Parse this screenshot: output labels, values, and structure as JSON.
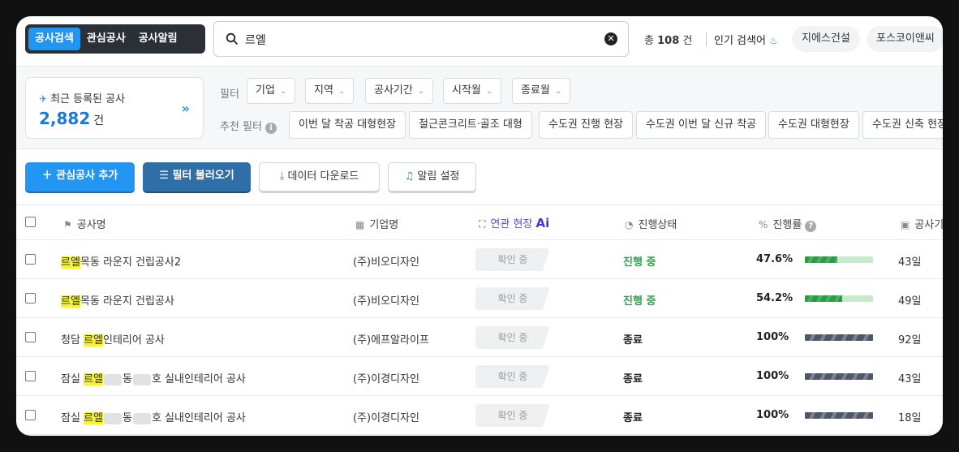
{
  "topbar": {
    "tabs": [
      {
        "label": "공사검색",
        "active": true
      },
      {
        "label": "관심공사",
        "active": false
      },
      {
        "label": "공사알림",
        "active": false
      }
    ],
    "search_value": "르엘",
    "total_prefix": "총",
    "total_count": "108",
    "total_unit": "건",
    "popular_label": "인기 검색어",
    "popular_chips": [
      "지에스건설",
      "포스코이앤씨"
    ]
  },
  "recent": {
    "title": "최근 등록된 공사",
    "count": "2,882",
    "unit": "건"
  },
  "filters": {
    "label": "필터",
    "dropdowns": [
      "기업",
      "지역",
      "공사기간",
      "시작월",
      "종료월"
    ],
    "recommend_label": "추천 필터",
    "recommend_chips": [
      "이번 달 착공 대형현장",
      "철근콘크리트·골조 대형",
      "수도권 진행 현장",
      "수도권 이번 달 신규 착공",
      "수도권 대형현장",
      "수도권 신축 현장"
    ]
  },
  "actions": {
    "add_interest": "관심공사 추가",
    "load_filter": "필터 불러오기",
    "download": "데이터 다운로드",
    "alert_setting": "알림 설정"
  },
  "table": {
    "headers": {
      "name": "공사명",
      "company": "기업명",
      "related": "연관 현장",
      "related_ai": "Ai",
      "status": "진행상태",
      "progress": "진행률",
      "period": "공사기간"
    },
    "rows": [
      {
        "pre": "",
        "hl": "르엘",
        "post": "목동 라운지 건립공사2",
        "blur": false,
        "company": "(주)비오디자인",
        "confirm": "확인 중",
        "status": "진행 중",
        "status_type": "green",
        "progress_text": "47.6%",
        "progress": 0.476,
        "days": "43일"
      },
      {
        "pre": "",
        "hl": "르엘",
        "post": "목동 라운지 건립공사",
        "blur": false,
        "company": "(주)비오디자인",
        "confirm": "확인 중",
        "status": "진행 중",
        "status_type": "green",
        "progress_text": "54.2%",
        "progress": 0.542,
        "days": "49일"
      },
      {
        "pre": "청담 ",
        "hl": "르엘",
        "post": "인테리어 공사",
        "blur": false,
        "company": "(주)에프알라이프",
        "confirm": "확인 중",
        "status": "종료",
        "status_type": "dark",
        "progress_text": "100%",
        "progress": 1.0,
        "days": "92일"
      },
      {
        "pre": "잠실 ",
        "hl": "르엘",
        "post": "호 실내인테리어 공사",
        "mid": "동",
        "blur": true,
        "company": "(주)이경디자인",
        "confirm": "확인 중",
        "status": "종료",
        "status_type": "dark",
        "progress_text": "100%",
        "progress": 1.0,
        "days": "43일"
      },
      {
        "pre": "잠실 ",
        "hl": "르엘",
        "post": "호 실내인테리어 공사",
        "mid": "동",
        "blur": true,
        "company": "(주)이경디자인",
        "confirm": "확인 중",
        "status": "종료",
        "status_type": "dark",
        "progress_text": "100%",
        "progress": 1.0,
        "days": "18일"
      }
    ]
  }
}
